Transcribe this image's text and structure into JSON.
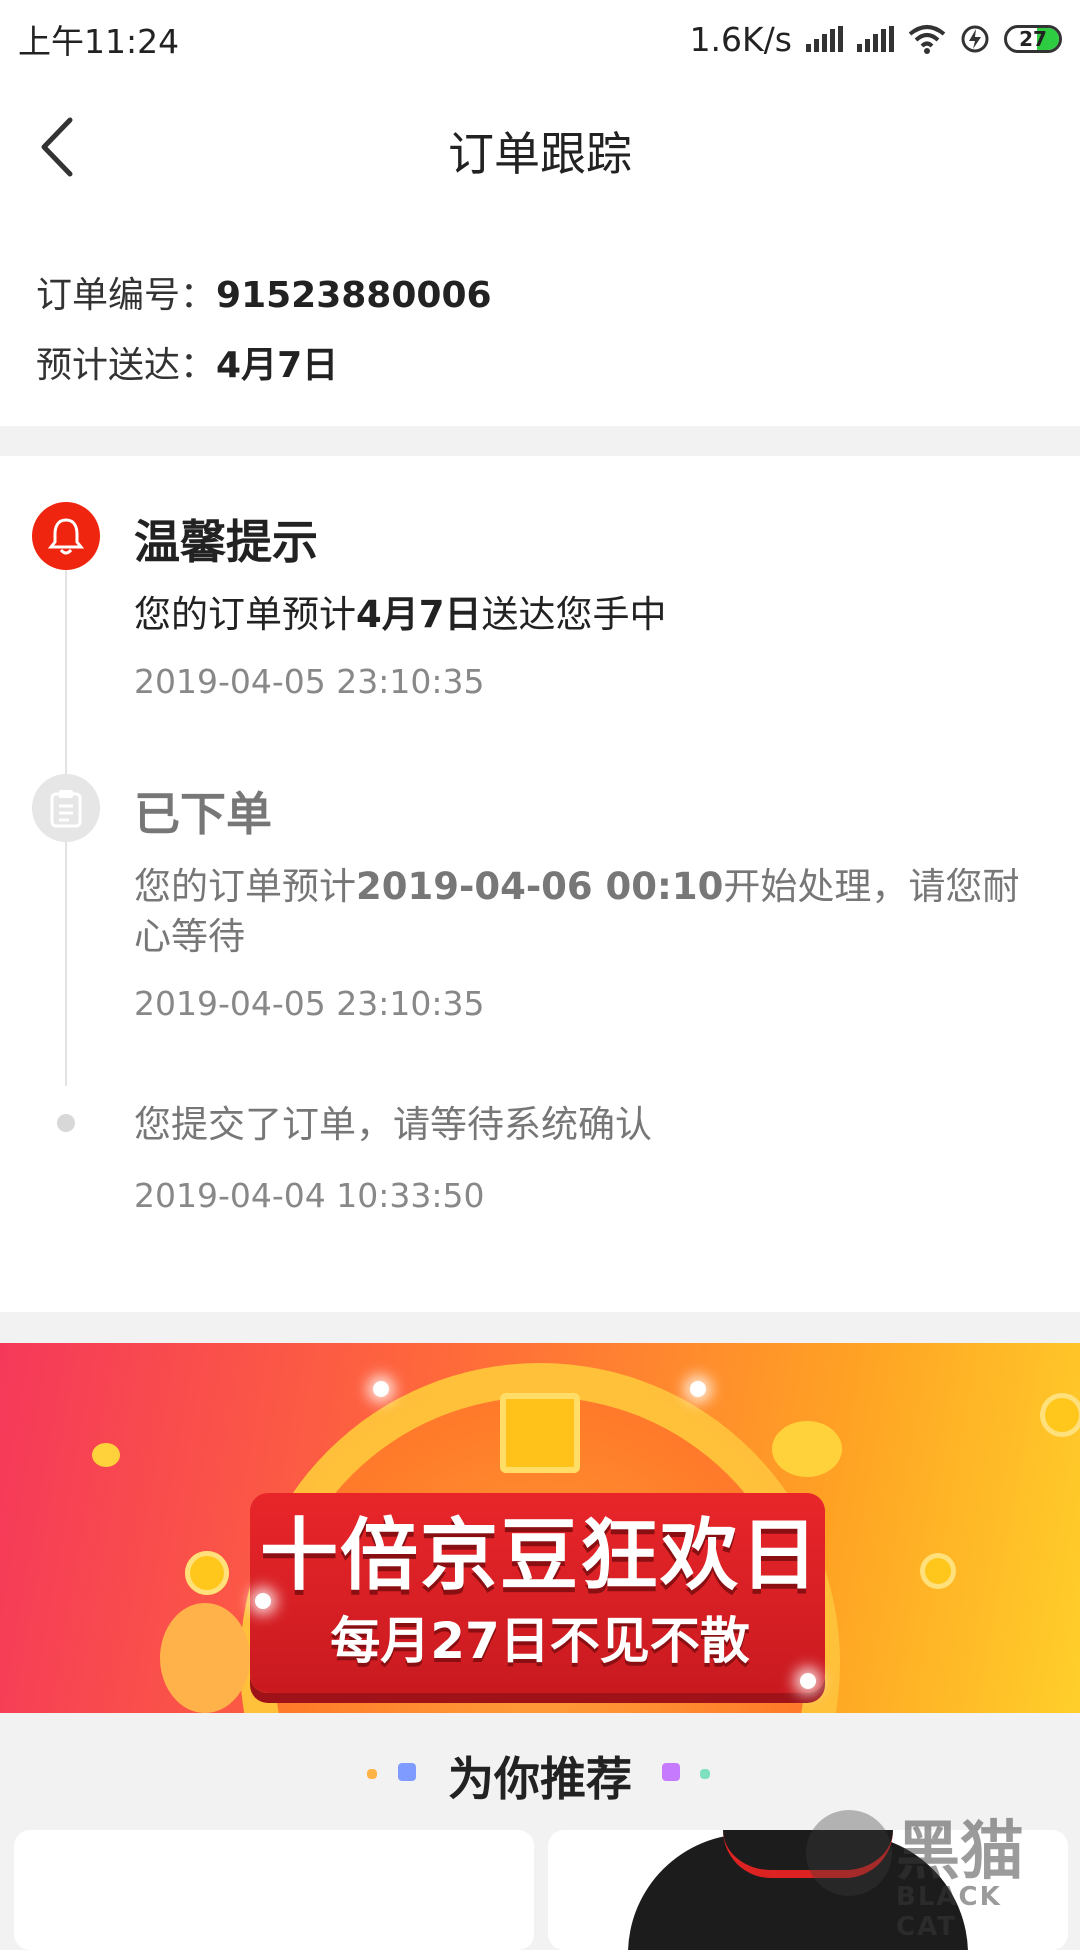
{
  "status_bar": {
    "time": "上午11:24",
    "network_speed": "1.6K/s",
    "battery_level": "27"
  },
  "navbar": {
    "title": "订单跟踪"
  },
  "order": {
    "number_label": "订单编号：",
    "number_value": "91523880006",
    "eta_label": "预计送达：",
    "eta_value": "4月7日"
  },
  "timeline": [
    {
      "title": "温馨提示",
      "desc_prefix": "您的订单预计",
      "desc_bold": "4月7日",
      "desc_suffix": "送达您手中",
      "time": "2019-04-05 23:10:35",
      "icon": "bell-icon"
    },
    {
      "title": "已下单",
      "desc_prefix": "您的订单预计",
      "desc_bold": "2019-04-06 00:10",
      "desc_suffix": "开始处理，请您耐心等待",
      "time": "2019-04-05 23:10:35",
      "icon": "clipboard-icon"
    },
    {
      "desc": "您提交了订单，请等待系统确认",
      "time": "2019-04-04 10:33:50"
    }
  ],
  "banner": {
    "title": "十倍京豆狂欢日",
    "subtitle": "每月27日不见不散"
  },
  "recommend": {
    "title": "为你推荐"
  },
  "watermark": {
    "text": "黑猫",
    "sub": "BLACK CAT"
  },
  "colors": {
    "accent_red": "#f0250f",
    "grey_text": "#888888"
  }
}
